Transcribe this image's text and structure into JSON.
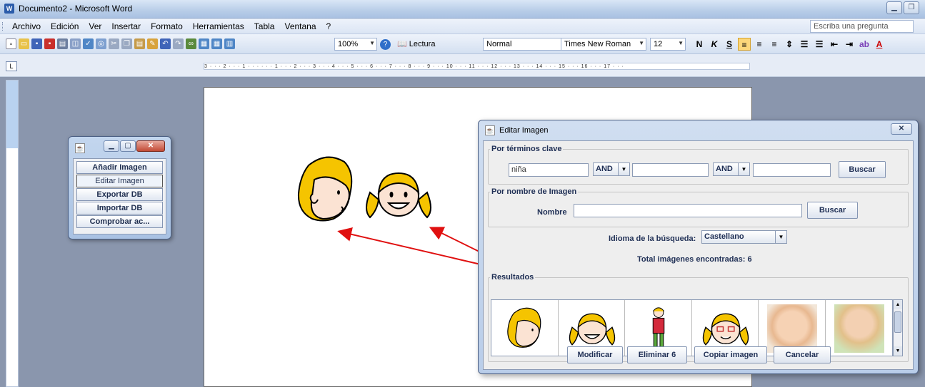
{
  "window": {
    "title": "Documento2 - Microsoft Word"
  },
  "menu": [
    "Archivo",
    "Edición",
    "Ver",
    "Insertar",
    "Formato",
    "Herramientas",
    "Tabla",
    "Ventana",
    "?"
  ],
  "ask_box": "Escriba una pregunta",
  "toolbar": {
    "zoom": "100%",
    "lectura": "Lectura",
    "style": "Normal",
    "font": "Times New Roman",
    "size": "12",
    "bold": "N",
    "italic": "K",
    "underline": "S"
  },
  "ruler_text": "3 · · · 2 · · · 1 · · · · · · 1 · · · 2 · · · 3 · · · 4 · · · 5 · · · 6 · · · 7 · · · 8 · · · 9 · · · 10 · · · 11 · · · 12 · · · 13 · · · 14 · · · 15 · · · 16 · · · 17 · · ·",
  "mini_window": {
    "buttons": [
      "Añadir Imagen",
      "Editar Imagen",
      "Exportar DB",
      "Importar DB",
      "Comprobar ac..."
    ]
  },
  "dialog": {
    "title": "Editar Imagen",
    "keywords_group": "Por términos clave",
    "keyword1": "niña",
    "op1": "AND",
    "op2": "AND",
    "search_btn1": "Buscar",
    "name_group": "Por nombre de Imagen",
    "name_label": "Nombre",
    "search_btn2": "Buscar",
    "lang_label": "Idioma de la búsqueda:",
    "lang_value": "Castellano",
    "total_label": "Total imágenes encontradas: 6",
    "results_group": "Resultados",
    "results": [
      "girl-profile-pictogram",
      "girl-face-pictogram",
      "girl-standing-pictogram",
      "girl-glasses-pictogram",
      "baby-photo",
      "toddler-photo"
    ],
    "buttons": {
      "modify": "Modificar",
      "delete": "Eliminar 6",
      "copy": "Copiar imagen",
      "cancel": "Cancelar"
    }
  },
  "colors": {
    "hair": "#f5c400",
    "arrow": "#e01010",
    "skin": "#fbe3d3"
  }
}
